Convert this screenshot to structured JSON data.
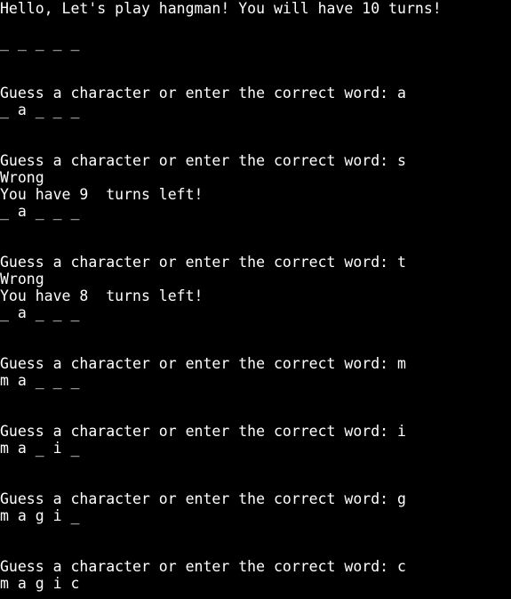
{
  "terminal": {
    "background": "#000000",
    "foreground": "#ffffff",
    "lines": [
      "Hello, Let's play hangman! You will have 10 turns!",
      "",
      "_ _ _ _ _",
      "",
      "",
      "Guess a character or enter the correct word: a",
      "_ a _ _ _",
      "",
      "",
      "Guess a character or enter the correct word: s",
      "Wrong",
      "You have 9  turns left!",
      "_ a _ _ _",
      "",
      "",
      "Guess a character or enter the correct word: t",
      "Wrong",
      "You have 8  turns left!",
      "_ a _ _ _",
      "",
      "",
      "Guess a character or enter the correct word: m",
      "m a _ _ _",
      "",
      "",
      "Guess a character or enter the correct word: i",
      "m a _ i _",
      "",
      "",
      "Guess a character or enter the correct word: g",
      "m a g i _",
      "",
      "",
      "Guess a character or enter the correct word: c",
      "m a g i c"
    ]
  }
}
